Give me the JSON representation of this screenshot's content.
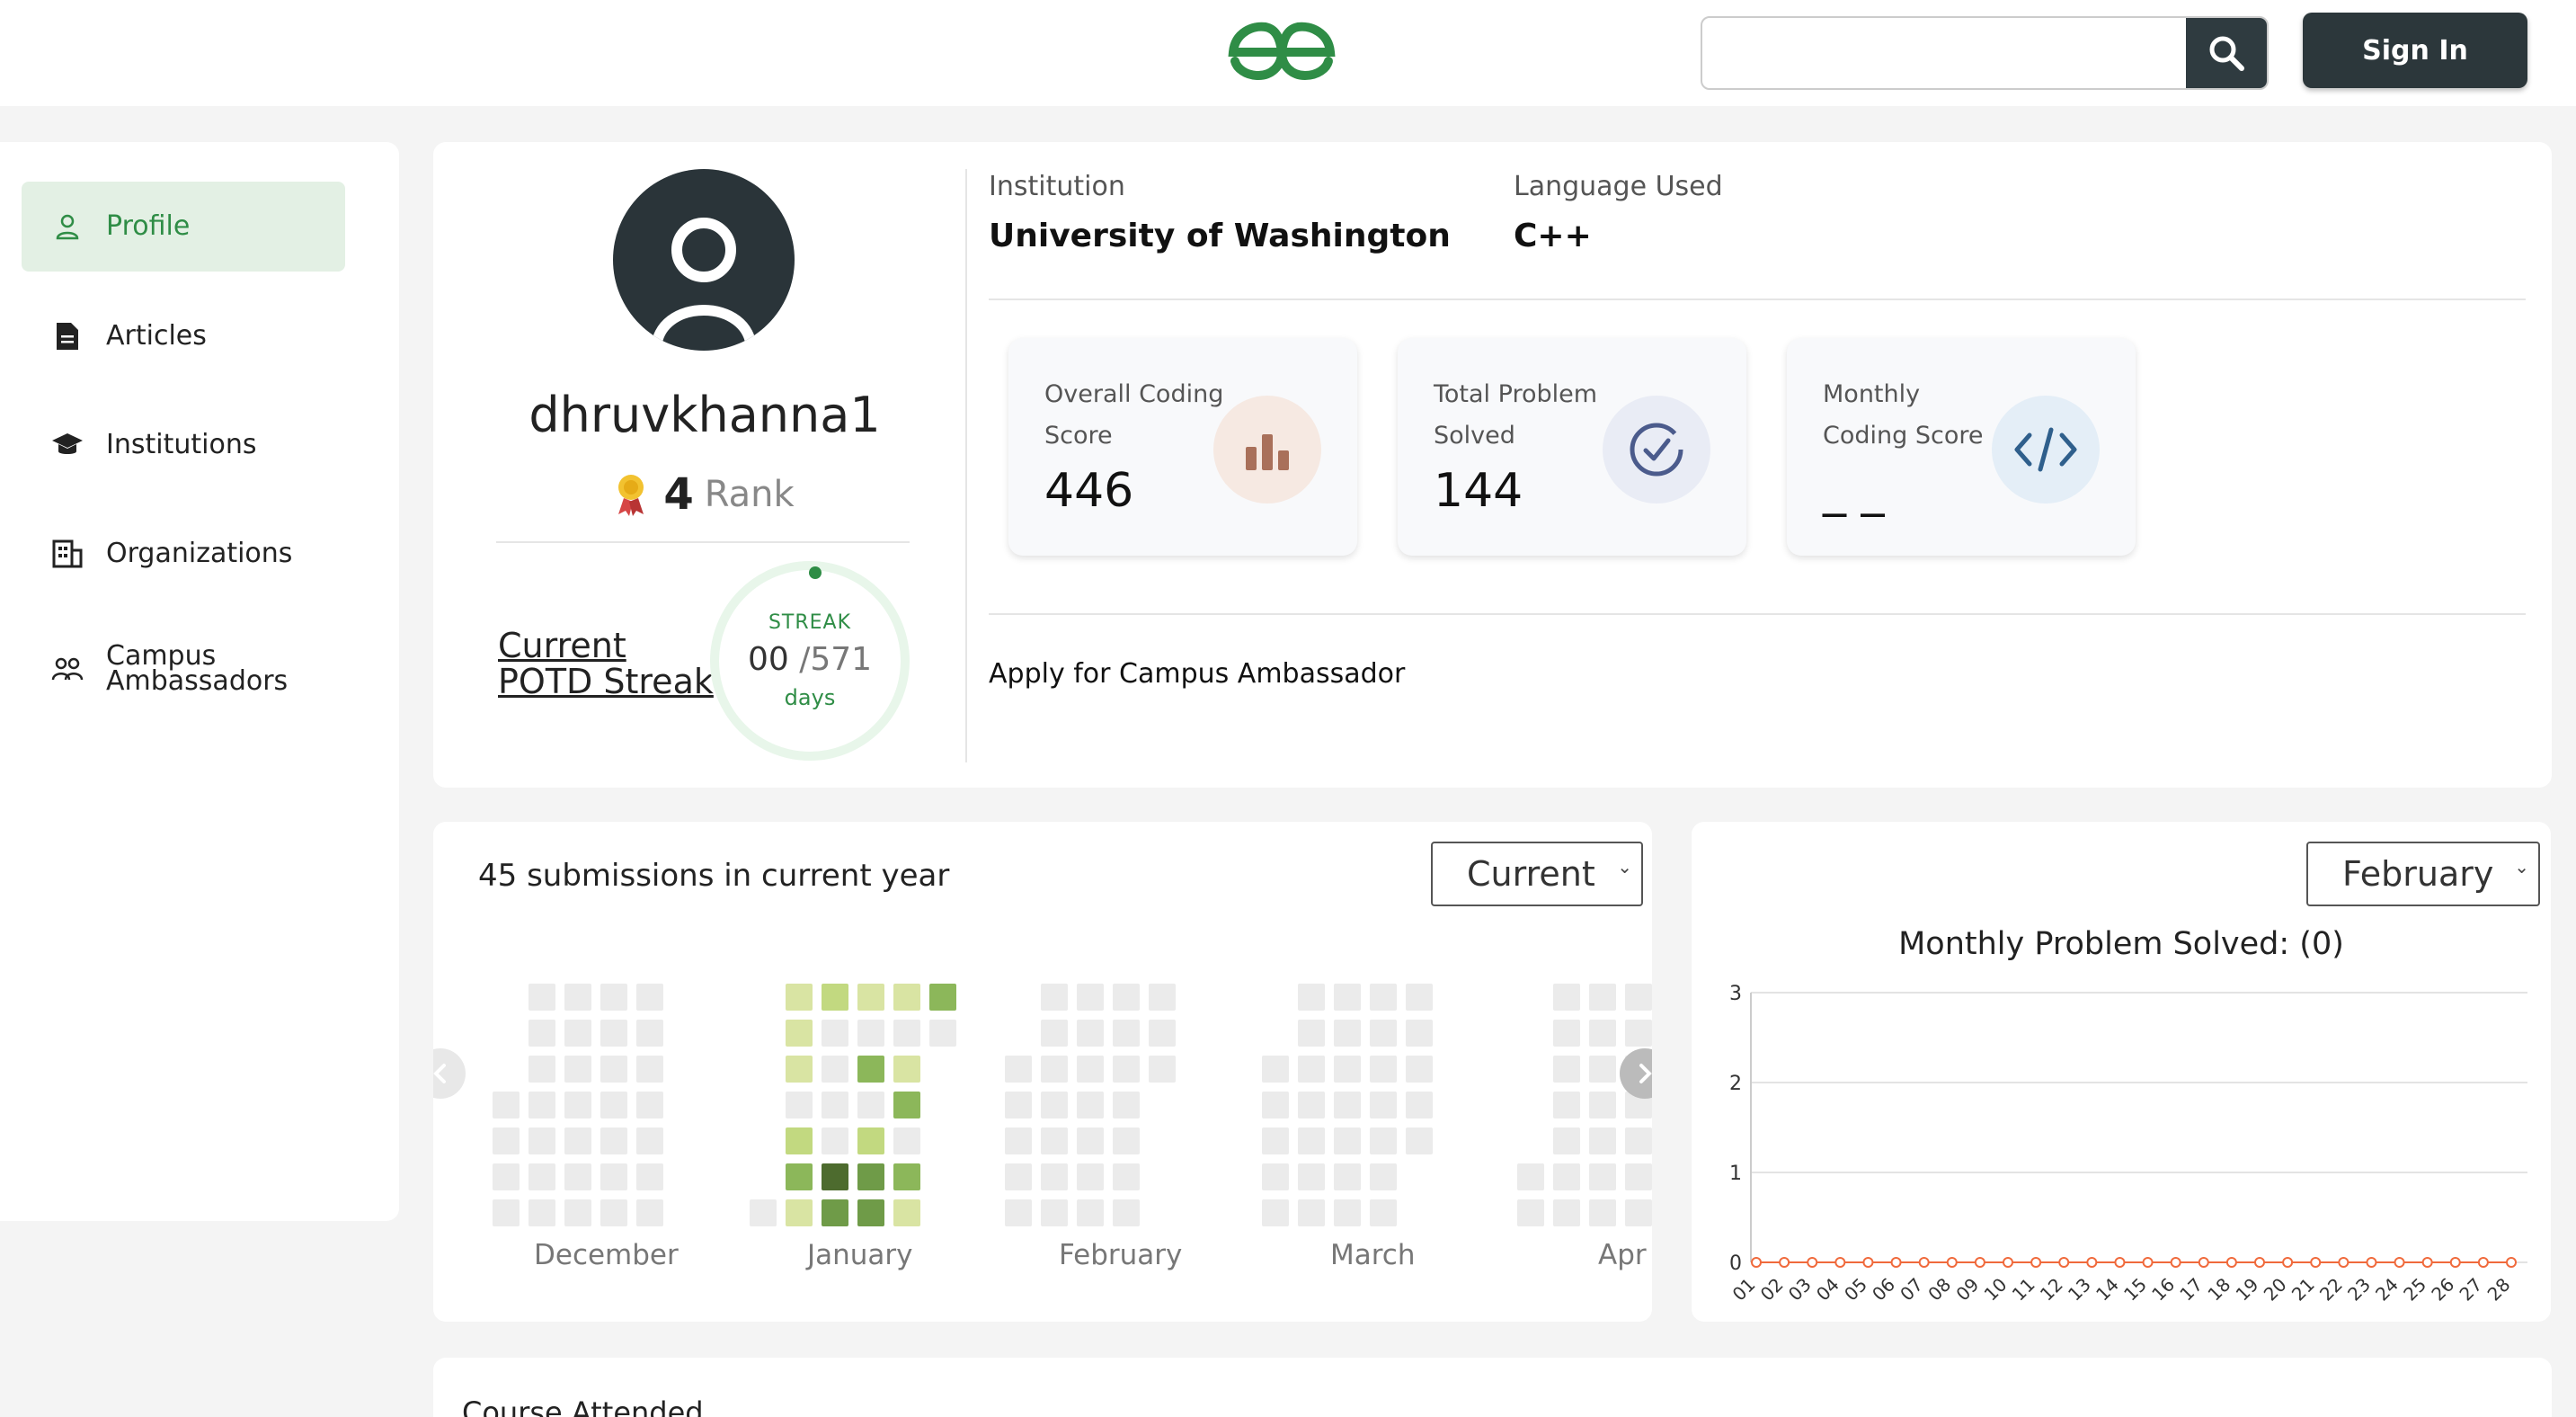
{
  "header": {
    "logo": "GfG",
    "search": {
      "placeholder": "",
      "value": ""
    },
    "signin_label": "Sign In"
  },
  "sidebar": {
    "items": [
      {
        "label": "Profile",
        "icon": "person-icon",
        "active": true
      },
      {
        "label": "Articles",
        "icon": "document-icon",
        "active": false
      },
      {
        "label": "Institutions",
        "icon": "graduation-cap-icon",
        "active": false
      },
      {
        "label": "Organizations",
        "icon": "building-icon",
        "active": false
      },
      {
        "label": "Campus Ambassadors",
        "label_line1": "Campus",
        "label_line2": "Ambassadors",
        "icon": "people-icon",
        "active": false
      }
    ]
  },
  "profile": {
    "username": "dhruvkhanna1",
    "rank_value": "4",
    "rank_label": "Rank",
    "potd_line1": "Current",
    "potd_line2": "POTD Streak",
    "streak_title": "STREAK",
    "streak_current": "00",
    "streak_total": "/571",
    "streak_unit": "days"
  },
  "meta": {
    "institution_label": "Institution",
    "institution_value": "University of Washington",
    "language_label": "Language Used",
    "language_value": "C++"
  },
  "stats": [
    {
      "label": "Overall Coding Score",
      "value": "446",
      "icon": "bar-chart-icon",
      "icon_bg": "#f6e9e2",
      "icon_color": "#a9705a"
    },
    {
      "label": "Total Problem Solved",
      "value": "144",
      "icon": "check-circle-icon",
      "icon_bg": "#e9ecf5",
      "icon_color": "#4b5b8c"
    },
    {
      "label": "Monthly Coding Score",
      "value": "_ _",
      "icon": "code-icon",
      "icon_bg": "#e4eef7",
      "icon_color": "#2f5f8c"
    }
  ],
  "campus_link": "Apply for Campus Ambassador",
  "submissions": {
    "title": "45 submissions in current year",
    "dropdown_value": "Current",
    "months": [
      "December",
      "January",
      "February",
      "March",
      "Apr"
    ],
    "colors": {
      "empty": "#ebebeb",
      "level1": "#d9e4a3",
      "level2": "#c2d980",
      "level3": "#8cb75a",
      "level4": "#6f9b48",
      "level5": "#4d6b2e"
    }
  },
  "monthly": {
    "dropdown_value": "February",
    "chart_data": {
      "type": "line",
      "title": "Monthly Problem Solved: (0)",
      "x": [
        "01",
        "02",
        "03",
        "04",
        "05",
        "06",
        "07",
        "08",
        "09",
        "10",
        "11",
        "12",
        "13",
        "14",
        "15",
        "16",
        "17",
        "18",
        "19",
        "20",
        "21",
        "22",
        "23",
        "24",
        "25",
        "26",
        "27",
        "28"
      ],
      "series": [
        {
          "values": [
            0,
            0,
            0,
            0,
            0,
            0,
            0,
            0,
            0,
            0,
            0,
            0,
            0,
            0,
            0,
            0,
            0,
            0,
            0,
            0,
            0,
            0,
            0,
            0,
            0,
            0,
            0,
            0
          ],
          "color": "#f06a3c"
        }
      ],
      "y_ticks": [
        "0",
        "1",
        "2",
        "3"
      ],
      "ylim": [
        0,
        3
      ],
      "grid": true
    }
  },
  "course": {
    "title": "Course Attended"
  },
  "colors": {
    "brand": "#2f8d46",
    "dark": "#2c373b"
  }
}
